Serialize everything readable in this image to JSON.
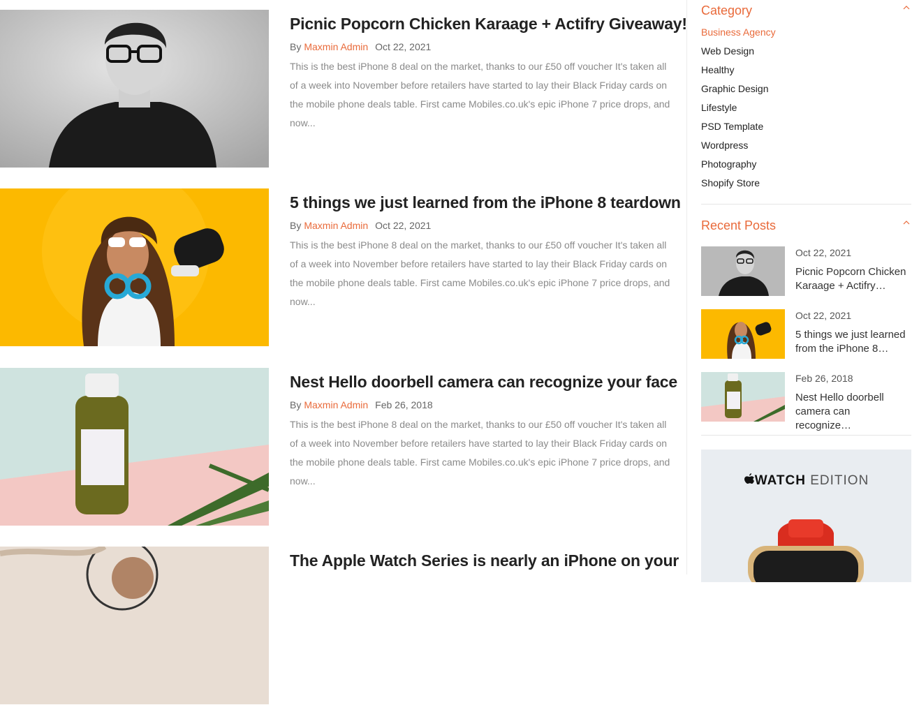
{
  "posts": [
    {
      "title": "Picnic Popcorn Chicken Karaage + Actifry Giveaway!",
      "by": "By",
      "author": "Maxmin Admin",
      "date": "Oct 22, 2021",
      "excerpt": "This is the best iPhone 8 deal on the market, thanks to our £50 off voucher It's taken all of a week into November before retailers have started to lay their Black Friday cards on the mobile phone deals table. First came Mobiles.co.uk's epic iPhone 7 price drops, and now..."
    },
    {
      "title": "5 things we just learned from the iPhone 8 teardown",
      "by": "By",
      "author": "Maxmin Admin",
      "date": "Oct 22, 2021",
      "excerpt": "This is the best iPhone 8 deal on the market, thanks to our £50 off voucher It's taken all of a week into November before retailers have started to lay their Black Friday cards on the mobile phone deals table. First came Mobiles.co.uk's epic iPhone 7 price drops, and now..."
    },
    {
      "title": "Nest Hello doorbell camera can recognize your face",
      "by": "By",
      "author": "Maxmin Admin",
      "date": "Feb 26, 2018",
      "excerpt": "This is the best iPhone 8 deal on the market, thanks to our £50 off voucher It's taken all of a week into November before retailers have started to lay their Black Friday cards on the mobile phone deals table. First came Mobiles.co.uk's epic iPhone 7 price drops, and now..."
    },
    {
      "title": "The Apple Watch Series is nearly an iPhone on your"
    }
  ],
  "sidebar": {
    "category": {
      "title": "Category",
      "items": [
        "Business Agency",
        "Web Design",
        "Healthy",
        "Graphic Design",
        "Lifestyle",
        "PSD Template",
        "Wordpress",
        "Photography",
        "Shopify Store"
      ]
    },
    "recent": {
      "title": "Recent Posts",
      "items": [
        {
          "date": "Oct 22, 2021",
          "title": "Picnic Popcorn Chicken Karaage + Actifry…"
        },
        {
          "date": "Oct 22, 2021",
          "title": "5 things we just learned from the iPhone 8…"
        },
        {
          "date": "Feb 26, 2018",
          "title": "Nest Hello doorbell camera can recognize…"
        }
      ]
    },
    "ad": {
      "brand": "WATCH",
      "edition": "EDITION"
    }
  },
  "colors": {
    "accent": "#e96a3a",
    "thumb_yellow": "#fcb900",
    "thumb_pink": "#f3c8c4",
    "thumb_mint": "#cfe3df"
  },
  "icons": {
    "collapse": "chevron-up-icon",
    "apple": "apple-logo-icon"
  }
}
